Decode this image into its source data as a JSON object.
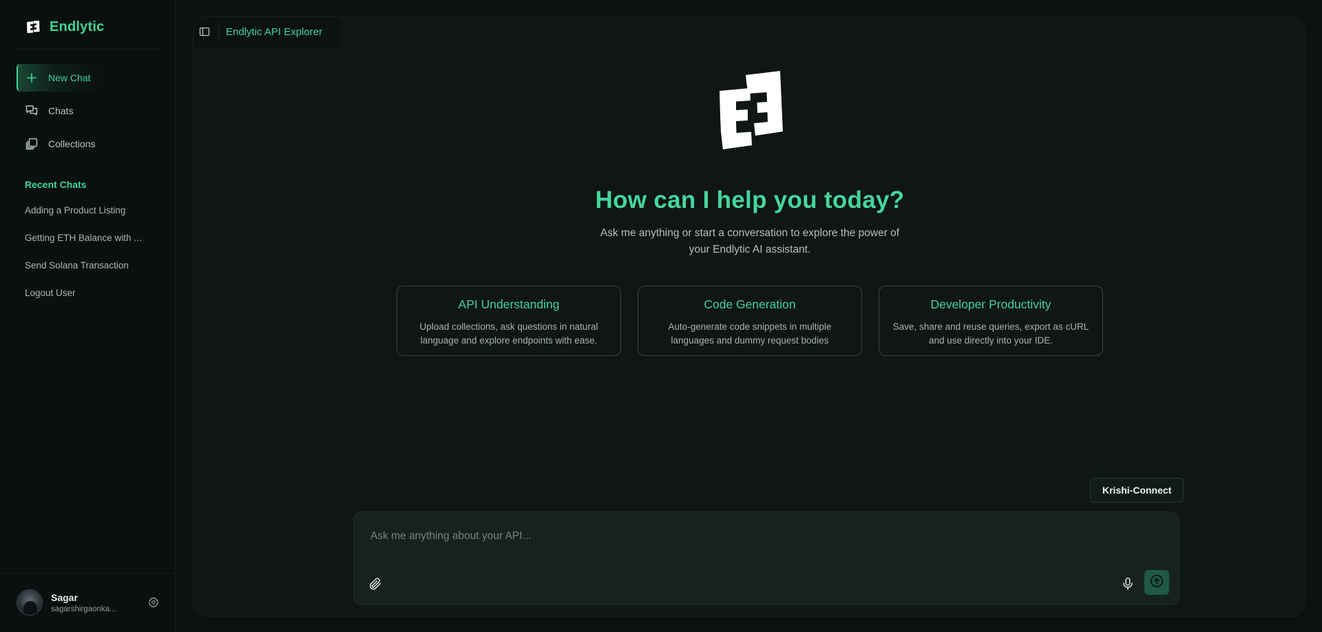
{
  "brand": {
    "name": "Endlytic",
    "accent": "#3ed598"
  },
  "nav": {
    "items": [
      {
        "label": "New Chat",
        "icon": "plus-icon",
        "active": true
      },
      {
        "label": "Chats",
        "icon": "chats-icon",
        "active": false
      },
      {
        "label": "Collections",
        "icon": "collections-icon",
        "active": false
      }
    ]
  },
  "recent": {
    "title": "Recent Chats",
    "items": [
      "Adding a Product Listing",
      "Getting ETH Balance with ...",
      "Send Solana Transaction",
      "Logout User"
    ]
  },
  "user": {
    "name": "Sagar",
    "email": "sagarshirgaonka...",
    "icon": "gear-icon"
  },
  "topbar": {
    "title": "Endlytic API Explorer",
    "toggle_icon": "sidebar-toggle-icon"
  },
  "hero": {
    "title": "How can I help you today?",
    "subtitle": "Ask me anything or start a conversation to explore the power of your Endlytic AI assistant."
  },
  "cards": [
    {
      "title": "API Understanding",
      "desc": "Upload collections, ask questions in natural language and explore endpoints with ease."
    },
    {
      "title": "Code Generation",
      "desc": "Auto-generate code snippets in multiple languages and dummy request bodies"
    },
    {
      "title": "Developer Productivity",
      "desc": "Save, share and reuse queries, export as cURL and use directly into your IDE."
    }
  ],
  "chip": {
    "label": "Krishi-Connect"
  },
  "composer": {
    "placeholder": "Ask me anything about your API...",
    "value": "",
    "attach_icon": "paperclip-icon",
    "mic_icon": "microphone-icon",
    "send_icon": "arrow-up-circle-icon"
  }
}
